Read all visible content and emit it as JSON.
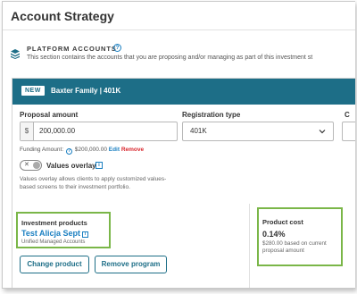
{
  "page": {
    "title": "Account Strategy"
  },
  "platform_accounts": {
    "title": "PLATFORM ACCOUNTS",
    "info_icon": "question-circle-icon",
    "icon": "layers-icon",
    "description": "This section contains the accounts that you are proposing and/or managing as part of this investment st"
  },
  "account": {
    "badge": "NEW",
    "name": "Baxter Family | 401K",
    "proposal_amount_label": "Proposal amount",
    "currency_prefix": "$",
    "proposal_amount_value": "200,000.00",
    "registration_type_label": "Registration type",
    "registration_type_value": "401K",
    "truncated_label": "C",
    "funding": {
      "label": "Funding Amount:",
      "amount": "$200,000.00",
      "edit": "Edit",
      "remove": "Remove"
    },
    "values_overlay": {
      "label": "Values overlay",
      "toggle_glyph": "✕",
      "info_glyph": "i",
      "description": "Values overlay allows clients to apply customized values-based screens to their investment portfolio."
    }
  },
  "investment_products": {
    "title": "Investment products",
    "name": "Test Alicja Sept",
    "info_glyph": "i",
    "subtitle": "Unified Managed Accounts",
    "change_button": "Change product",
    "remove_button": "Remove program"
  },
  "product_cost": {
    "title": "Product cost",
    "value": "0.14%",
    "description": "$280.00 based on current proposal amount"
  },
  "colors": {
    "header": "#1d6e87",
    "link": "#1a7fc1",
    "remove": "#d9272e",
    "highlight": "#7ab648"
  }
}
